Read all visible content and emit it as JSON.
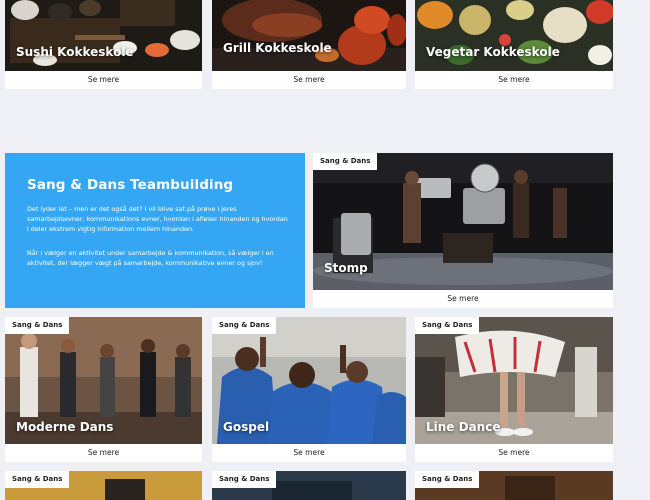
{
  "top_row": [
    {
      "title": "Sushi Kokkeskole",
      "more": "Se mere"
    },
    {
      "title": "Grill Kokkeskole",
      "more": "Se mere"
    },
    {
      "title": "Vegetar Kokkeskole",
      "more": "Se mere"
    }
  ],
  "promo": {
    "heading": "Sang & Dans Teambuilding",
    "para1": "Det lyder let – men er det også det? I vil blive sat på prøve i jeres samarbejdsevner, kommunikations evner, hvordan i afløser hinanden og hvordan i deler ekstrem vigtig information mellem hinanden.",
    "para2": "Når i vælger en aktivitet under samarbejde & kommunikation, så vælger i en aktivitet, der lægger vægt på samarbejde, kommunikative evner og sjov!"
  },
  "featured": {
    "badge": "Sang & Dans",
    "title": "Stomp",
    "more": "Se mere"
  },
  "middle_row": [
    {
      "badge": "Sang & Dans",
      "title": "Moderne Dans",
      "more": "Se mere"
    },
    {
      "badge": "Sang & Dans",
      "title": "Gospel",
      "more": "Se mere"
    },
    {
      "badge": "Sang & Dans",
      "title": "Line Dance",
      "more": "Se mere"
    }
  ],
  "bottom_row": [
    {
      "badge": "Sang & Dans"
    },
    {
      "badge": "Sang & Dans"
    },
    {
      "badge": "Sang & Dans"
    }
  ]
}
